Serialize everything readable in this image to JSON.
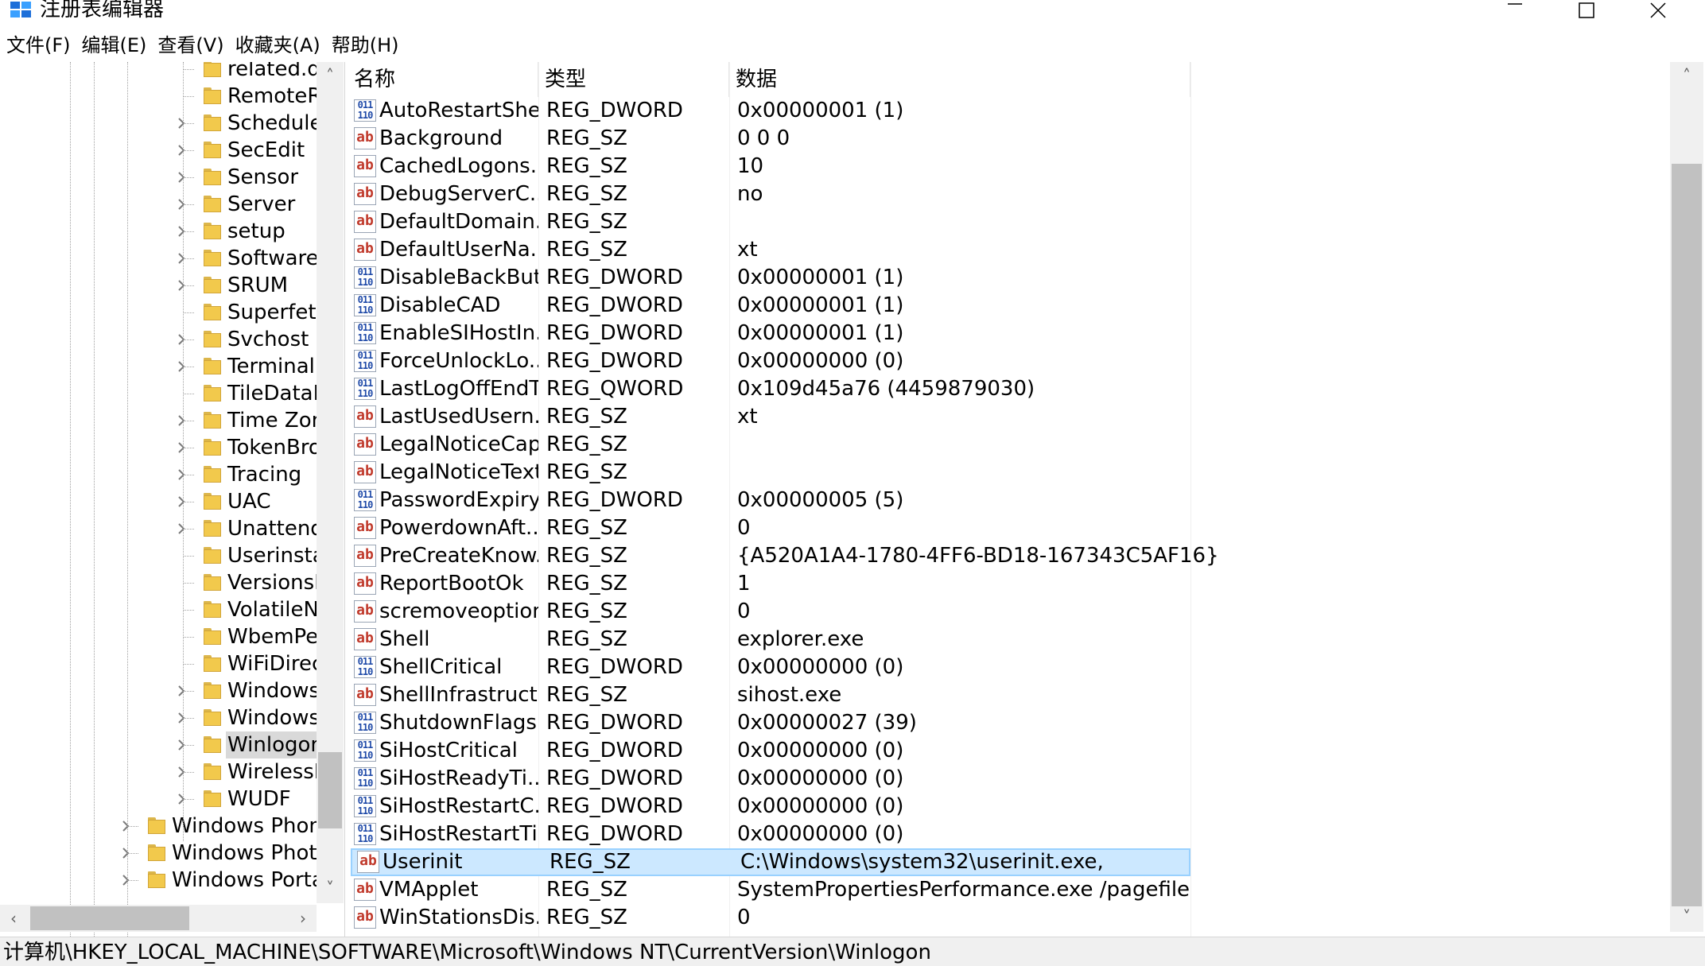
{
  "window": {
    "title": "注册表编辑器",
    "app_icon": "regedit-icon",
    "controls": [
      "minimize-icon",
      "maximize-icon",
      "close-icon"
    ]
  },
  "menu": [
    "文件(F)",
    "编辑(E)",
    "查看(V)",
    "收藏夹(A)",
    "帮助(H)"
  ],
  "tree": {
    "items": [
      {
        "label": "related.de",
        "expandable": false,
        "level": 2,
        "selected": false
      },
      {
        "label": "RemoteR",
        "expandable": false,
        "level": 2,
        "selected": false
      },
      {
        "label": "Schedule",
        "expandable": true,
        "level": 2,
        "selected": false
      },
      {
        "label": "SecEdit",
        "expandable": true,
        "level": 2,
        "selected": false
      },
      {
        "label": "Sensor",
        "expandable": true,
        "level": 2,
        "selected": false
      },
      {
        "label": "Server",
        "expandable": true,
        "level": 2,
        "selected": false
      },
      {
        "label": "setup",
        "expandable": true,
        "level": 2,
        "selected": false
      },
      {
        "label": "SoftwareP",
        "expandable": true,
        "level": 2,
        "selected": false
      },
      {
        "label": "SRUM",
        "expandable": true,
        "level": 2,
        "selected": false
      },
      {
        "label": "Superfetc",
        "expandable": false,
        "level": 2,
        "selected": false
      },
      {
        "label": "Svchost",
        "expandable": true,
        "level": 2,
        "selected": false
      },
      {
        "label": "Terminal S",
        "expandable": true,
        "level": 2,
        "selected": false
      },
      {
        "label": "TileDataM",
        "expandable": false,
        "level": 2,
        "selected": false
      },
      {
        "label": "Time Zon",
        "expandable": true,
        "level": 2,
        "selected": false
      },
      {
        "label": "TokenBro",
        "expandable": true,
        "level": 2,
        "selected": false
      },
      {
        "label": "Tracing",
        "expandable": true,
        "level": 2,
        "selected": false
      },
      {
        "label": "UAC",
        "expandable": true,
        "level": 2,
        "selected": false
      },
      {
        "label": "Unattend",
        "expandable": true,
        "level": 2,
        "selected": false
      },
      {
        "label": "Userinstal",
        "expandable": false,
        "level": 2,
        "selected": false
      },
      {
        "label": "VersionsL",
        "expandable": false,
        "level": 2,
        "selected": false
      },
      {
        "label": "VolatileNo",
        "expandable": false,
        "level": 2,
        "selected": false
      },
      {
        "label": "WbemPer",
        "expandable": false,
        "level": 2,
        "selected": false
      },
      {
        "label": "WiFiDirec",
        "expandable": false,
        "level": 2,
        "selected": false
      },
      {
        "label": "Windows",
        "expandable": true,
        "level": 2,
        "selected": false
      },
      {
        "label": "Windows!",
        "expandable": true,
        "level": 2,
        "selected": false
      },
      {
        "label": "Winlogon",
        "expandable": true,
        "level": 2,
        "selected": true
      },
      {
        "label": "WirelessD",
        "expandable": true,
        "level": 2,
        "selected": false
      },
      {
        "label": "WUDF",
        "expandable": true,
        "level": 2,
        "selected": false
      },
      {
        "label": "Windows Phone",
        "expandable": true,
        "level": 1,
        "selected": false
      },
      {
        "label": "Windows Photo",
        "expandable": true,
        "level": 1,
        "selected": false
      },
      {
        "label": "Windows Portal",
        "expandable": true,
        "level": 1,
        "selected": false
      }
    ]
  },
  "list": {
    "columns": {
      "name": "名称",
      "type": "类型",
      "data": "数据"
    },
    "rows": [
      {
        "name": "AutoRestartShell",
        "type": "REG_DWORD",
        "data": "0x00000001 (1)",
        "icon": "binary-value-icon"
      },
      {
        "name": "Background",
        "type": "REG_SZ",
        "data": "0 0 0",
        "icon": "string-value-icon"
      },
      {
        "name": "CachedLogons...",
        "type": "REG_SZ",
        "data": "10",
        "icon": "string-value-icon"
      },
      {
        "name": "DebugServerC...",
        "type": "REG_SZ",
        "data": "no",
        "icon": "string-value-icon"
      },
      {
        "name": "DefaultDomain...",
        "type": "REG_SZ",
        "data": "",
        "icon": "string-value-icon"
      },
      {
        "name": "DefaultUserNa...",
        "type": "REG_SZ",
        "data": "xt",
        "icon": "string-value-icon"
      },
      {
        "name": "DisableBackBut...",
        "type": "REG_DWORD",
        "data": "0x00000001 (1)",
        "icon": "binary-value-icon"
      },
      {
        "name": "DisableCAD",
        "type": "REG_DWORD",
        "data": "0x00000001 (1)",
        "icon": "binary-value-icon"
      },
      {
        "name": "EnableSIHostIn...",
        "type": "REG_DWORD",
        "data": "0x00000001 (1)",
        "icon": "binary-value-icon"
      },
      {
        "name": "ForceUnlockLo...",
        "type": "REG_DWORD",
        "data": "0x00000000 (0)",
        "icon": "binary-value-icon"
      },
      {
        "name": "LastLogOffEndT...",
        "type": "REG_QWORD",
        "data": "0x109d45a76 (4459879030)",
        "icon": "binary-value-icon"
      },
      {
        "name": "LastUsedUsern...",
        "type": "REG_SZ",
        "data": "xt",
        "icon": "string-value-icon"
      },
      {
        "name": "LegalNoticeCap...",
        "type": "REG_SZ",
        "data": "",
        "icon": "string-value-icon"
      },
      {
        "name": "LegalNoticeText",
        "type": "REG_SZ",
        "data": "",
        "icon": "string-value-icon"
      },
      {
        "name": "PasswordExpiry...",
        "type": "REG_DWORD",
        "data": "0x00000005 (5)",
        "icon": "binary-value-icon"
      },
      {
        "name": "PowerdownAft...",
        "type": "REG_SZ",
        "data": "0",
        "icon": "string-value-icon"
      },
      {
        "name": "PreCreateKnow...",
        "type": "REG_SZ",
        "data": "{A520A1A4-1780-4FF6-BD18-167343C5AF16}",
        "icon": "string-value-icon"
      },
      {
        "name": "ReportBootOk",
        "type": "REG_SZ",
        "data": "1",
        "icon": "string-value-icon"
      },
      {
        "name": "scremoveoption",
        "type": "REG_SZ",
        "data": "0",
        "icon": "string-value-icon"
      },
      {
        "name": "Shell",
        "type": "REG_SZ",
        "data": "explorer.exe",
        "icon": "string-value-icon"
      },
      {
        "name": "ShellCritical",
        "type": "REG_DWORD",
        "data": "0x00000000 (0)",
        "icon": "binary-value-icon"
      },
      {
        "name": "ShellInfrastruct...",
        "type": "REG_SZ",
        "data": "sihost.exe",
        "icon": "string-value-icon"
      },
      {
        "name": "ShutdownFlags",
        "type": "REG_DWORD",
        "data": "0x00000027 (39)",
        "icon": "binary-value-icon"
      },
      {
        "name": "SiHostCritical",
        "type": "REG_DWORD",
        "data": "0x00000000 (0)",
        "icon": "binary-value-icon"
      },
      {
        "name": "SiHostReadyTi...",
        "type": "REG_DWORD",
        "data": "0x00000000 (0)",
        "icon": "binary-value-icon"
      },
      {
        "name": "SiHostRestartC...",
        "type": "REG_DWORD",
        "data": "0x00000000 (0)",
        "icon": "binary-value-icon"
      },
      {
        "name": "SiHostRestartTi...",
        "type": "REG_DWORD",
        "data": "0x00000000 (0)",
        "icon": "binary-value-icon"
      },
      {
        "name": "Userinit",
        "type": "REG_SZ",
        "data": "C:\\Windows\\system32\\userinit.exe,",
        "icon": "string-value-icon",
        "selected": true
      },
      {
        "name": "VMApplet",
        "type": "REG_SZ",
        "data": "SystemPropertiesPerformance.exe /pagefile",
        "icon": "string-value-icon"
      },
      {
        "name": "WinStationsDis...",
        "type": "REG_SZ",
        "data": "0",
        "icon": "string-value-icon"
      }
    ]
  },
  "status": {
    "path": "计算机\\HKEY_LOCAL_MACHINE\\SOFTWARE\\Microsoft\\Windows NT\\CurrentVersion\\Winlogon"
  },
  "colors": {
    "selection": "#cce8ff",
    "selection_border": "#99d1ff",
    "tree_selection": "#d9d9d9",
    "folder": "#f2c94c",
    "scrollbar_thumb": "#c1c1c1",
    "scrollbar_track": "#f0f0f0"
  }
}
